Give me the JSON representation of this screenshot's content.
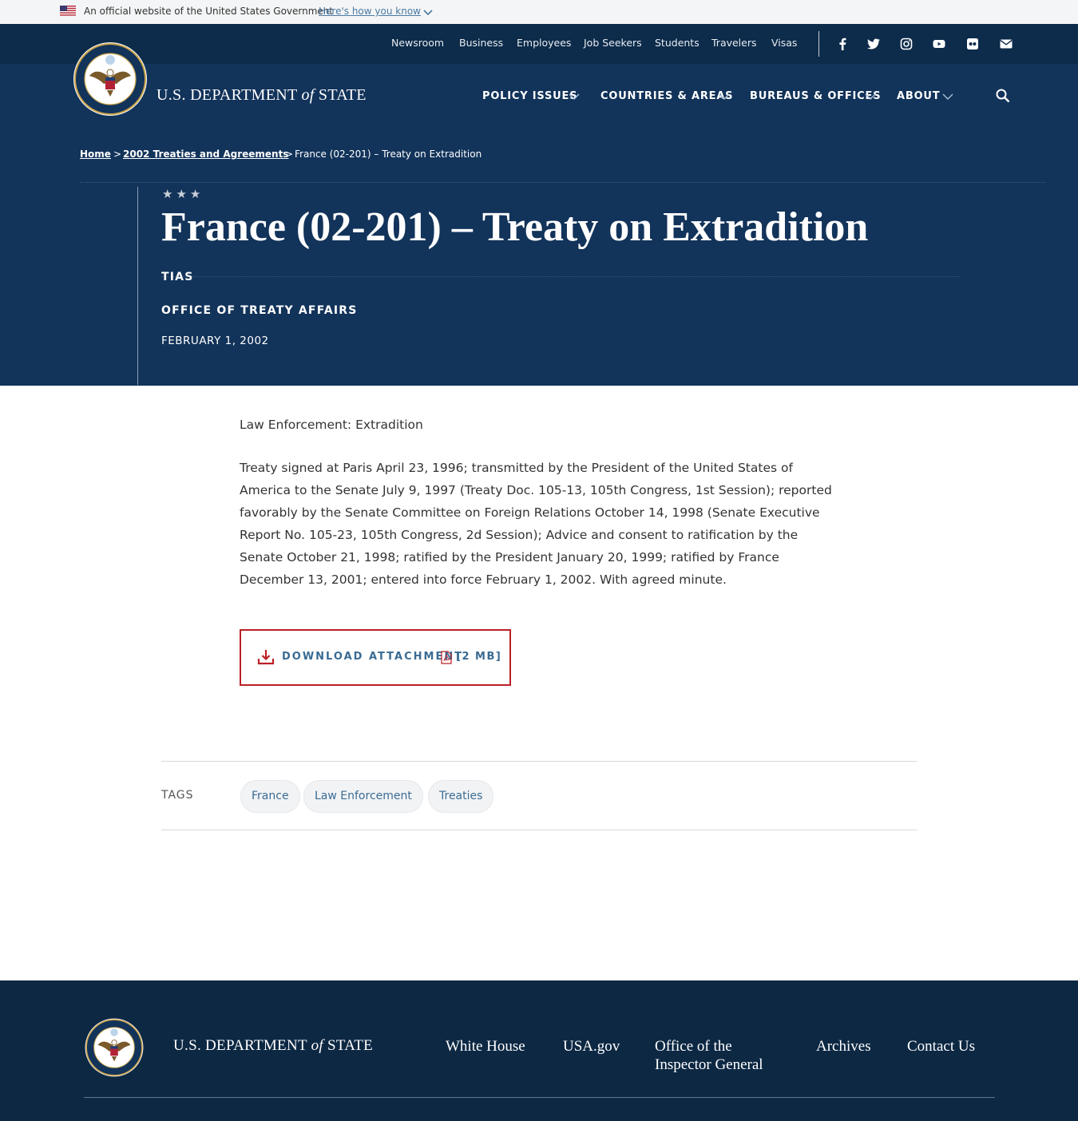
{
  "gov_banner": {
    "text": "An official website of the United States Government",
    "link": "Here's how you know"
  },
  "utility_nav": [
    "Newsroom",
    "Business",
    "Employees",
    "Job Seekers",
    "Students",
    "Travelers",
    "Visas"
  ],
  "social_icons": [
    "facebook-icon",
    "twitter-icon",
    "instagram-icon",
    "youtube-icon",
    "flickr-icon",
    "email-icon"
  ],
  "brand": {
    "pre": "U.S. DEPARTMENT",
    "of": "of",
    "post": "STATE"
  },
  "main_nav": [
    "POLICY ISSUES",
    "COUNTRIES & AREAS",
    "BUREAUS & OFFICES",
    "ABOUT"
  ],
  "breadcrumb": {
    "home": "Home",
    "parent": "2002 Treaties and Agreements",
    "current": "France (02-201) – Treaty on Extradition",
    "separator": ">"
  },
  "article": {
    "stars": "★★★",
    "title": "France (02-201) – Treaty on Extradition",
    "tag_line": "TIAS",
    "office": "OFFICE OF TREATY AFFAIRS",
    "date": "FEBRUARY 1, 2002",
    "subject": "Law Enforcement: Extradition",
    "summary": "Treaty signed at Paris April 23, 1996; transmitted by the President of the United States of America to the Senate July 9, 1997 (Treaty Doc. 105-13, 105th Congress, 1st Session); reported favorably by the Senate Committee on Foreign Relations October 14, 1998 (Senate Executive Report No. 105-23, 105th Congress, 2d Session); Advice and consent to ratification by the Senate October 21, 1998; ratified by the President January 20, 1999; ratified by France December 13, 2001; entered into force February 1, 2002. With agreed minute.",
    "download_label": "DOWNLOAD ATTACHMENT",
    "download_size": "[2 MB]"
  },
  "tags": {
    "label": "TAGS",
    "items": [
      "France",
      "Law Enforcement",
      "Treaties"
    ]
  },
  "footer": {
    "links": [
      "White House",
      "USA.gov",
      "Office of the Inspector General",
      "Archives",
      "Contact Us"
    ],
    "inspector_line1": "Office of the",
    "inspector_line2": "Inspector General"
  },
  "colors": {
    "header_blue": "#12335a",
    "utility_blue": "#0d2b4a",
    "footer_blue": "#0d2843",
    "download_border": "#bb2026",
    "link_blue": "#3a6b93"
  }
}
